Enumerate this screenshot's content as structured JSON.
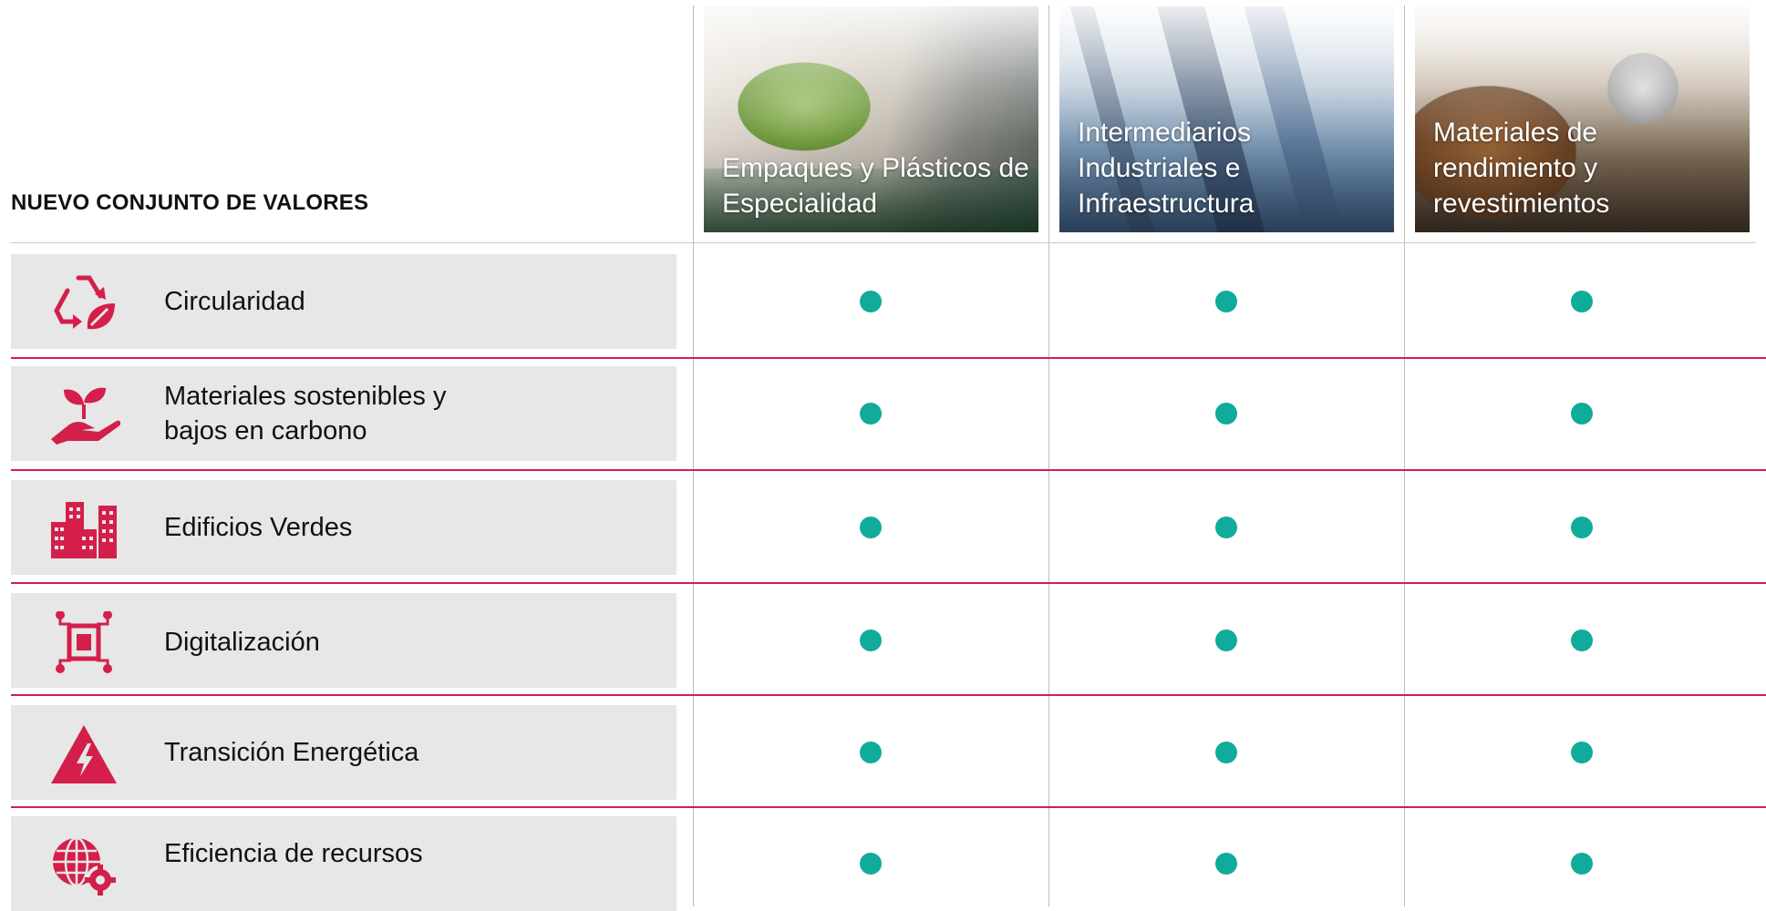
{
  "header": {
    "title": "NUEVO CONJUNTO DE VALORES",
    "segments": [
      {
        "label": "Empaques y Plásticos de Especialidad"
      },
      {
        "label": "Intermediarios Industriales e Infraestructura"
      },
      {
        "label": "Materiales de rendimiento y revestimientos"
      }
    ]
  },
  "rows": [
    {
      "label": "Circularidad",
      "icon": "recycle-leaf-icon",
      "marks": [
        "●",
        "●",
        "●"
      ]
    },
    {
      "label": "Materiales sostenibles y bajos en carbono",
      "icon": "hand-sprout-icon",
      "marks": [
        "●",
        "●",
        "●"
      ]
    },
    {
      "label": "Edificios Verdes",
      "icon": "buildings-icon",
      "marks": [
        "●",
        "●",
        "●"
      ]
    },
    {
      "label": "Digitalización",
      "icon": "chip-circuit-icon",
      "marks": [
        "●",
        "●",
        "●"
      ]
    },
    {
      "label": "Transición Energética",
      "icon": "high-voltage-icon",
      "marks": [
        "●",
        "●",
        "●"
      ]
    },
    {
      "label": "Eficiencia de recursos",
      "icon": "globe-gear-icon",
      "marks": [
        "●",
        "●",
        "●"
      ]
    }
  ],
  "colors": {
    "accent_red": "#d31f4a",
    "dot_teal": "#10ab9b",
    "row_bg": "#e7e7e7"
  }
}
